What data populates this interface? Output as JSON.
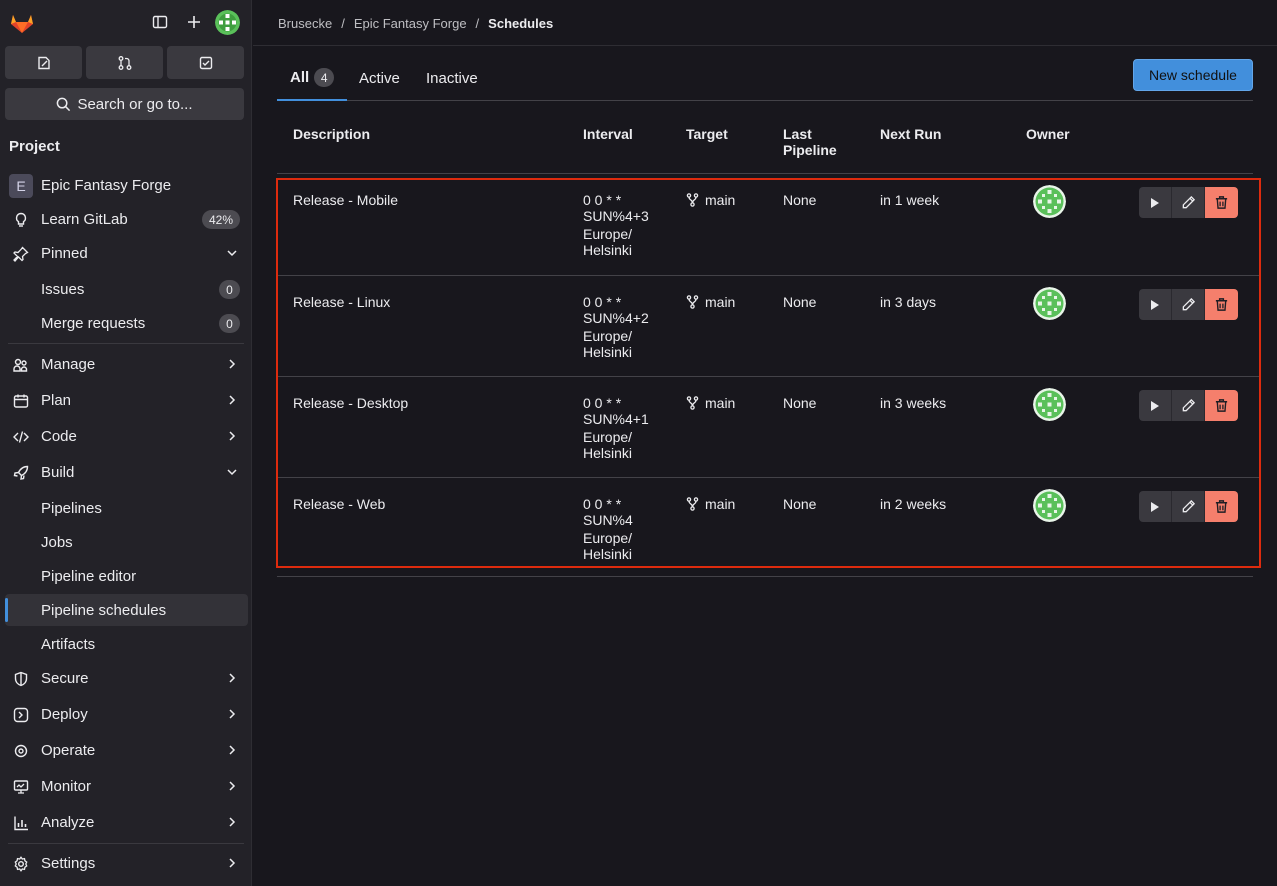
{
  "sidebar": {
    "search_label": "Search or go to...",
    "heading": "Project",
    "project_initial": "E",
    "project_name": "Epic Fantasy Forge",
    "learn": {
      "label": "Learn GitLab",
      "badge": "42%"
    },
    "pinned": {
      "label": "Pinned",
      "items": [
        {
          "label": "Issues",
          "count": "0"
        },
        {
          "label": "Merge requests",
          "count": "0"
        }
      ]
    },
    "manage": "Manage",
    "plan": "Plan",
    "code": "Code",
    "build": {
      "label": "Build",
      "items": [
        "Pipelines",
        "Jobs",
        "Pipeline editor",
        "Pipeline schedules",
        "Artifacts"
      ]
    },
    "secure": "Secure",
    "deploy": "Deploy",
    "operate": "Operate",
    "monitor": "Monitor",
    "analyze": "Analyze",
    "settings": "Settings"
  },
  "breadcrumb": {
    "items": [
      "Brusecke",
      "Epic Fantasy Forge"
    ],
    "separator": "/",
    "current": "Schedules"
  },
  "tabs": [
    {
      "label": "All",
      "count": "4"
    },
    {
      "label": "Active"
    },
    {
      "label": "Inactive"
    }
  ],
  "new_schedule_label": "New schedule",
  "table": {
    "headers": {
      "description": "Description",
      "interval": "Interval",
      "target": "Target",
      "last_pipeline_1": "Last",
      "last_pipeline_2": "Pipeline",
      "next_run": "Next Run",
      "owner": "Owner"
    },
    "rows": [
      {
        "description": "Release - Mobile",
        "cron1": "0 0 * *",
        "cron2": "SUN%4+3",
        "tz1": "Europe/",
        "tz2": "Helsinki",
        "target": "main",
        "last_pipeline": "None",
        "next_run": "in 1 week"
      },
      {
        "description": "Release - Linux",
        "cron1": "0 0 * *",
        "cron2": "SUN%4+2",
        "tz1": "Europe/",
        "tz2": "Helsinki",
        "target": "main",
        "last_pipeline": "None",
        "next_run": "in 3 days"
      },
      {
        "description": "Release - Desktop",
        "cron1": "0 0 * *",
        "cron2": "SUN%4+1",
        "tz1": "Europe/",
        "tz2": "Helsinki",
        "target": "main",
        "last_pipeline": "None",
        "next_run": "in 3 weeks"
      },
      {
        "description": "Release - Web",
        "cron1": "0 0 * *",
        "cron2": "SUN%4",
        "tz1": "Europe/",
        "tz2": "Helsinki",
        "target": "main",
        "last_pipeline": "None",
        "next_run": "in 2 weeks"
      }
    ]
  },
  "colors": {
    "accent": "#428fdc",
    "danger": "#f57f6c",
    "highlight": "#dd2b0e",
    "avatar": "#5ac05a"
  }
}
